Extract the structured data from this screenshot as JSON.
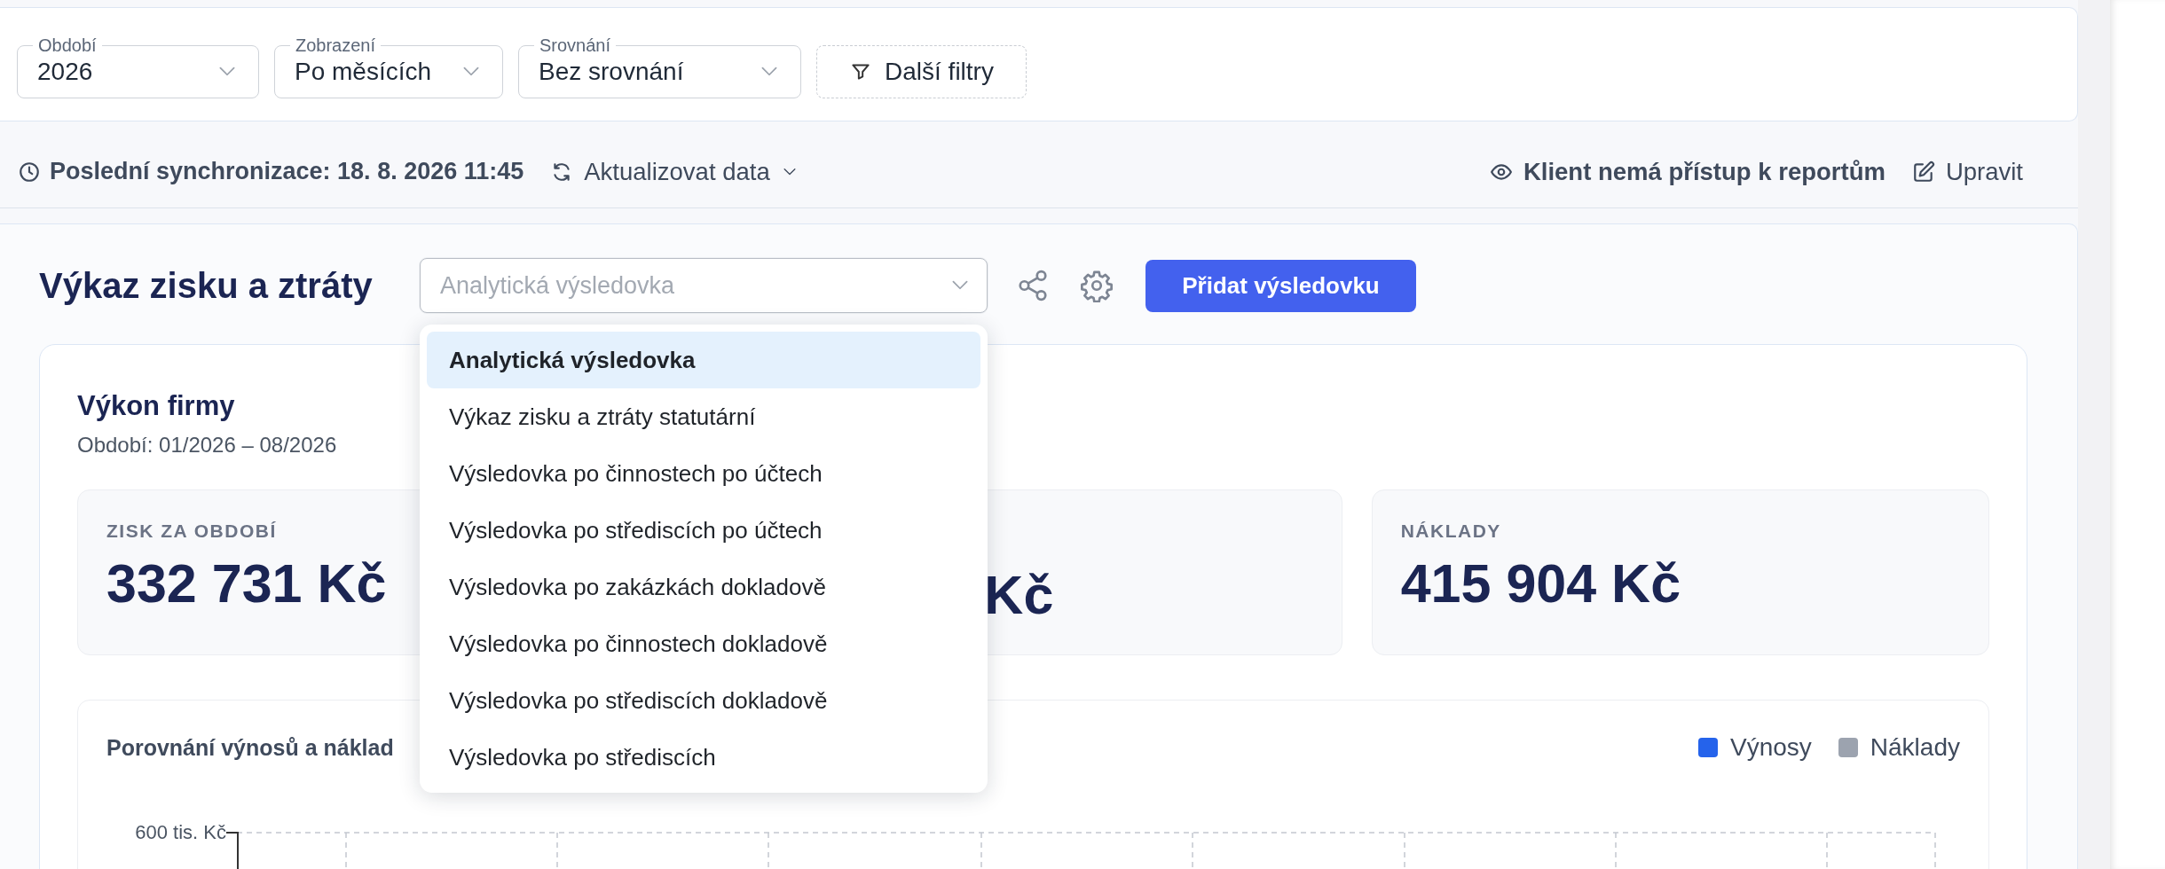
{
  "filters": [
    {
      "label": "Období",
      "value": "2026"
    },
    {
      "label": "Zobrazení",
      "value": "Po měsících"
    },
    {
      "label": "Srovnání",
      "value": "Bez srovnání"
    }
  ],
  "more_filters_button": "Další filtry",
  "sync_bar": {
    "last_sync": "Poslední synchronizace: 18. 8. 2026 11:45",
    "refresh": "Aktualizovat data",
    "client_access": "Klient nemá přístup k reportům",
    "edit": "Upravit"
  },
  "report": {
    "title": "Výkaz zisku a ztráty",
    "report_select": {
      "placeholder": "Analytická výsledovka",
      "expanded": true
    },
    "add_button": "Přidat výsledovku",
    "dropdown_options": [
      {
        "label": "Analytická výsledovka",
        "selected": true
      },
      {
        "label": "Výkaz zisku a ztráty statutární",
        "selected": false
      },
      {
        "label": "Výsledovka po činnostech po účtech",
        "selected": false
      },
      {
        "label": "Výsledovka po střediscích po účtech",
        "selected": false
      },
      {
        "label": "Výsledovka po zakázkách dokladově",
        "selected": false
      },
      {
        "label": "Výsledovka po činnostech dokladově",
        "selected": false
      },
      {
        "label": "Výsledovka po střediscích dokladově",
        "selected": false
      },
      {
        "label": "Výsledovka po střediscích",
        "selected": false
      }
    ],
    "summary": {
      "title": "Výkon firmy",
      "period": "Období: 01/2026 – 08/2026",
      "kpis": [
        {
          "label": "ZISK ZA OBDOBÍ",
          "value": "332 731 Kč"
        },
        {
          "value": "Kč"
        },
        {
          "label": "NÁKLADY",
          "value": "415 904 Kč"
        }
      ]
    },
    "chart": {
      "title": "Porovnání výnosů a náklad",
      "legend": [
        {
          "name": "Výnosy",
          "color": "#2563eb"
        },
        {
          "name": "Náklady",
          "color": "#9ca3af"
        }
      ],
      "y_tick_label": "600 tis. Kč"
    }
  }
}
